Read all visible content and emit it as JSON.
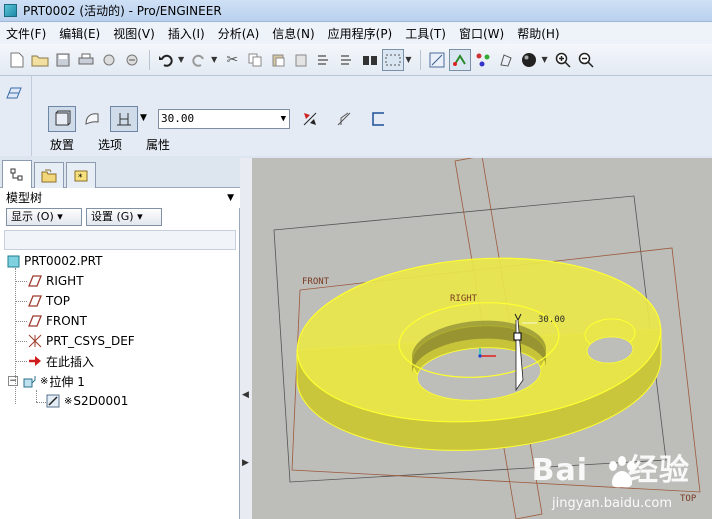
{
  "window": {
    "title": "PRT0002 (活动的) - Pro/ENGINEER"
  },
  "menu": [
    "文件(F)",
    "编辑(E)",
    "视图(V)",
    "插入(I)",
    "分析(A)",
    "信息(N)",
    "应用程序(P)",
    "工具(T)",
    "窗口(W)",
    "帮助(H)"
  ],
  "dashboard": {
    "depth_value": "30.00",
    "tabs": [
      "放置",
      "选项",
      "属性"
    ]
  },
  "model_tree": {
    "header": "模型树",
    "show_button": "显示 (O) ▾",
    "settings_button": "设置 (G) ▾",
    "root": "PRT0002.PRT",
    "items": [
      "RIGHT",
      "TOP",
      "FRONT",
      "PRT_CSYS_DEF",
      "在此插入",
      "拉伸 1",
      "S2D0001"
    ]
  },
  "viewport": {
    "labels": {
      "front": "FRONT",
      "right": "RIGHT",
      "top": "TOP",
      "dimension": "30.00"
    },
    "watermark": {
      "brand_left": "Bai",
      "brand_right": "经验",
      "url": "jingyan.baidu.com"
    }
  },
  "colors": {
    "model_fill": "#e8e64a",
    "model_edge": "#ffff30",
    "datum_plane": "#9c5a3c",
    "viewport_bg": "#bdbdba"
  }
}
